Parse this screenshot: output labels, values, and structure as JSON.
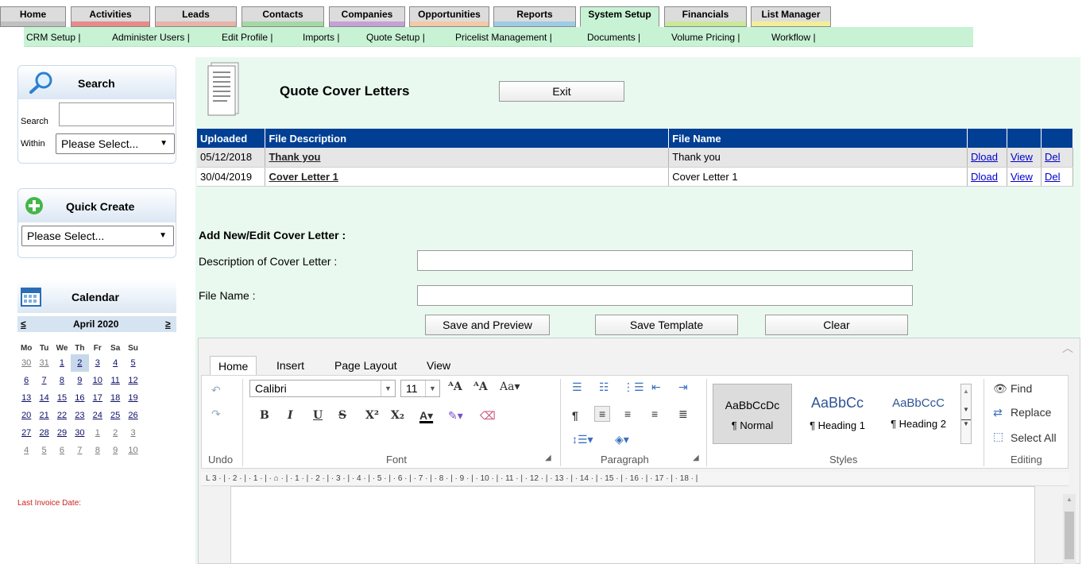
{
  "top_nav": {
    "tabs": [
      {
        "label": "Home",
        "color": "#c0c0c0",
        "active": false
      },
      {
        "label": "Activities",
        "color": "#e88a8a",
        "active": false
      },
      {
        "label": "Leads",
        "color": "#e8b3a8",
        "active": false
      },
      {
        "label": "Contacts",
        "color": "#a6d8a6",
        "active": false
      },
      {
        "label": "Companies",
        "color": "#c6a0d8",
        "active": false
      },
      {
        "label": "Opportunities",
        "color": "#f3c9a8",
        "active": false
      },
      {
        "label": "Reports",
        "color": "#9ecbe8",
        "active": false
      },
      {
        "label": "System Setup",
        "color": "#b8e6c4",
        "active": true
      },
      {
        "label": "Financials",
        "color": "#c9e89a",
        "active": false
      },
      {
        "label": "List Manager",
        "color": "#f2ef98",
        "active": false
      }
    ],
    "subnav": [
      "CRM Setup |",
      "Administer Users |",
      "Edit Profile |",
      "Imports |",
      "Quote Setup |",
      "Pricelist Management |",
      "Documents |",
      "Volume Pricing |",
      "Workflow |"
    ]
  },
  "sidebar": {
    "search": {
      "title": "Search",
      "field_label": "Search",
      "within_label": "Within",
      "within_value": "Please Select..."
    },
    "quick_create": {
      "title": "Quick Create",
      "value": "Please Select..."
    },
    "calendar": {
      "title": "Calendar",
      "prev": "≤",
      "next": "≥",
      "month": "April 2020",
      "weekdays": [
        "Mo",
        "Tu",
        "We",
        "Th",
        "Fr",
        "Sa",
        "Su"
      ],
      "weeks": [
        [
          "30",
          "31",
          "1",
          "2",
          "3",
          "4",
          "5"
        ],
        [
          "6",
          "7",
          "8",
          "9",
          "10",
          "11",
          "12"
        ],
        [
          "13",
          "14",
          "15",
          "16",
          "17",
          "18",
          "19"
        ],
        [
          "20",
          "21",
          "22",
          "23",
          "24",
          "25",
          "26"
        ],
        [
          "27",
          "28",
          "29",
          "30",
          "1",
          "2",
          "3"
        ],
        [
          "4",
          "5",
          "6",
          "7",
          "8",
          "9",
          "10"
        ]
      ],
      "today": "2"
    },
    "last_invoice_label": "Last Invoice Date:"
  },
  "main": {
    "title": "Quote Cover Letters",
    "exit_label": "Exit",
    "table": {
      "headers": [
        "Uploaded",
        "File Description",
        "File Name",
        "",
        "",
        ""
      ],
      "rows": [
        {
          "uploaded": "05/12/2018",
          "description": "Thank you",
          "file_name": "Thank you",
          "dload": "Dload",
          "view": "View",
          "del": "Del"
        },
        {
          "uploaded": "30/04/2019",
          "description": "Cover Letter 1",
          "file_name": "Cover Letter 1",
          "dload": "Dload",
          "view": "View",
          "del": "Del"
        }
      ]
    },
    "form": {
      "heading": "Add New/Edit Cover Letter :",
      "description_label": "Description of Cover Letter :",
      "description_value": "",
      "filename_label": "File Name :",
      "filename_value": "",
      "save_preview_label": "Save and Preview",
      "save_template_label": "Save Template",
      "clear_label": "Clear"
    }
  },
  "editor": {
    "tabs": [
      "Home",
      "Insert",
      "Page Layout",
      "View"
    ],
    "active_tab": "Home",
    "undo_label": "Undo",
    "font_name": "Calibri",
    "font_size": "11",
    "font_group_label": "Font",
    "paragraph_group_label": "Paragraph",
    "styles_group_label": "Styles",
    "editing_group_label": "Editing",
    "styles": [
      {
        "sample": "AaBbCcDc",
        "name": "¶ Normal"
      },
      {
        "sample": "AaBbCc",
        "name": "¶ Heading 1"
      },
      {
        "sample": "AaBbCcC",
        "name": "¶ Heading 2"
      }
    ],
    "find_label": "Find",
    "replace_label": "Replace",
    "select_all_label": "Select All",
    "ruler_text": "L  3 · | · 2 · | · 1 · | · ⌂ · | · 1 · | · 2 · | · 3 · | · 4 · | · 5 · | · 6 · | · 7 · | · 8 · | · 9 · | · 10 · | · 11 · | · 12 · | · 13 · | · 14 · | · 15 · | · 16 · | · 17 · | · 18 · |"
  },
  "colors": {
    "accent_green": "#c8f2d4",
    "header_blue": "#003f94",
    "invoice_red": "#cc2222"
  }
}
